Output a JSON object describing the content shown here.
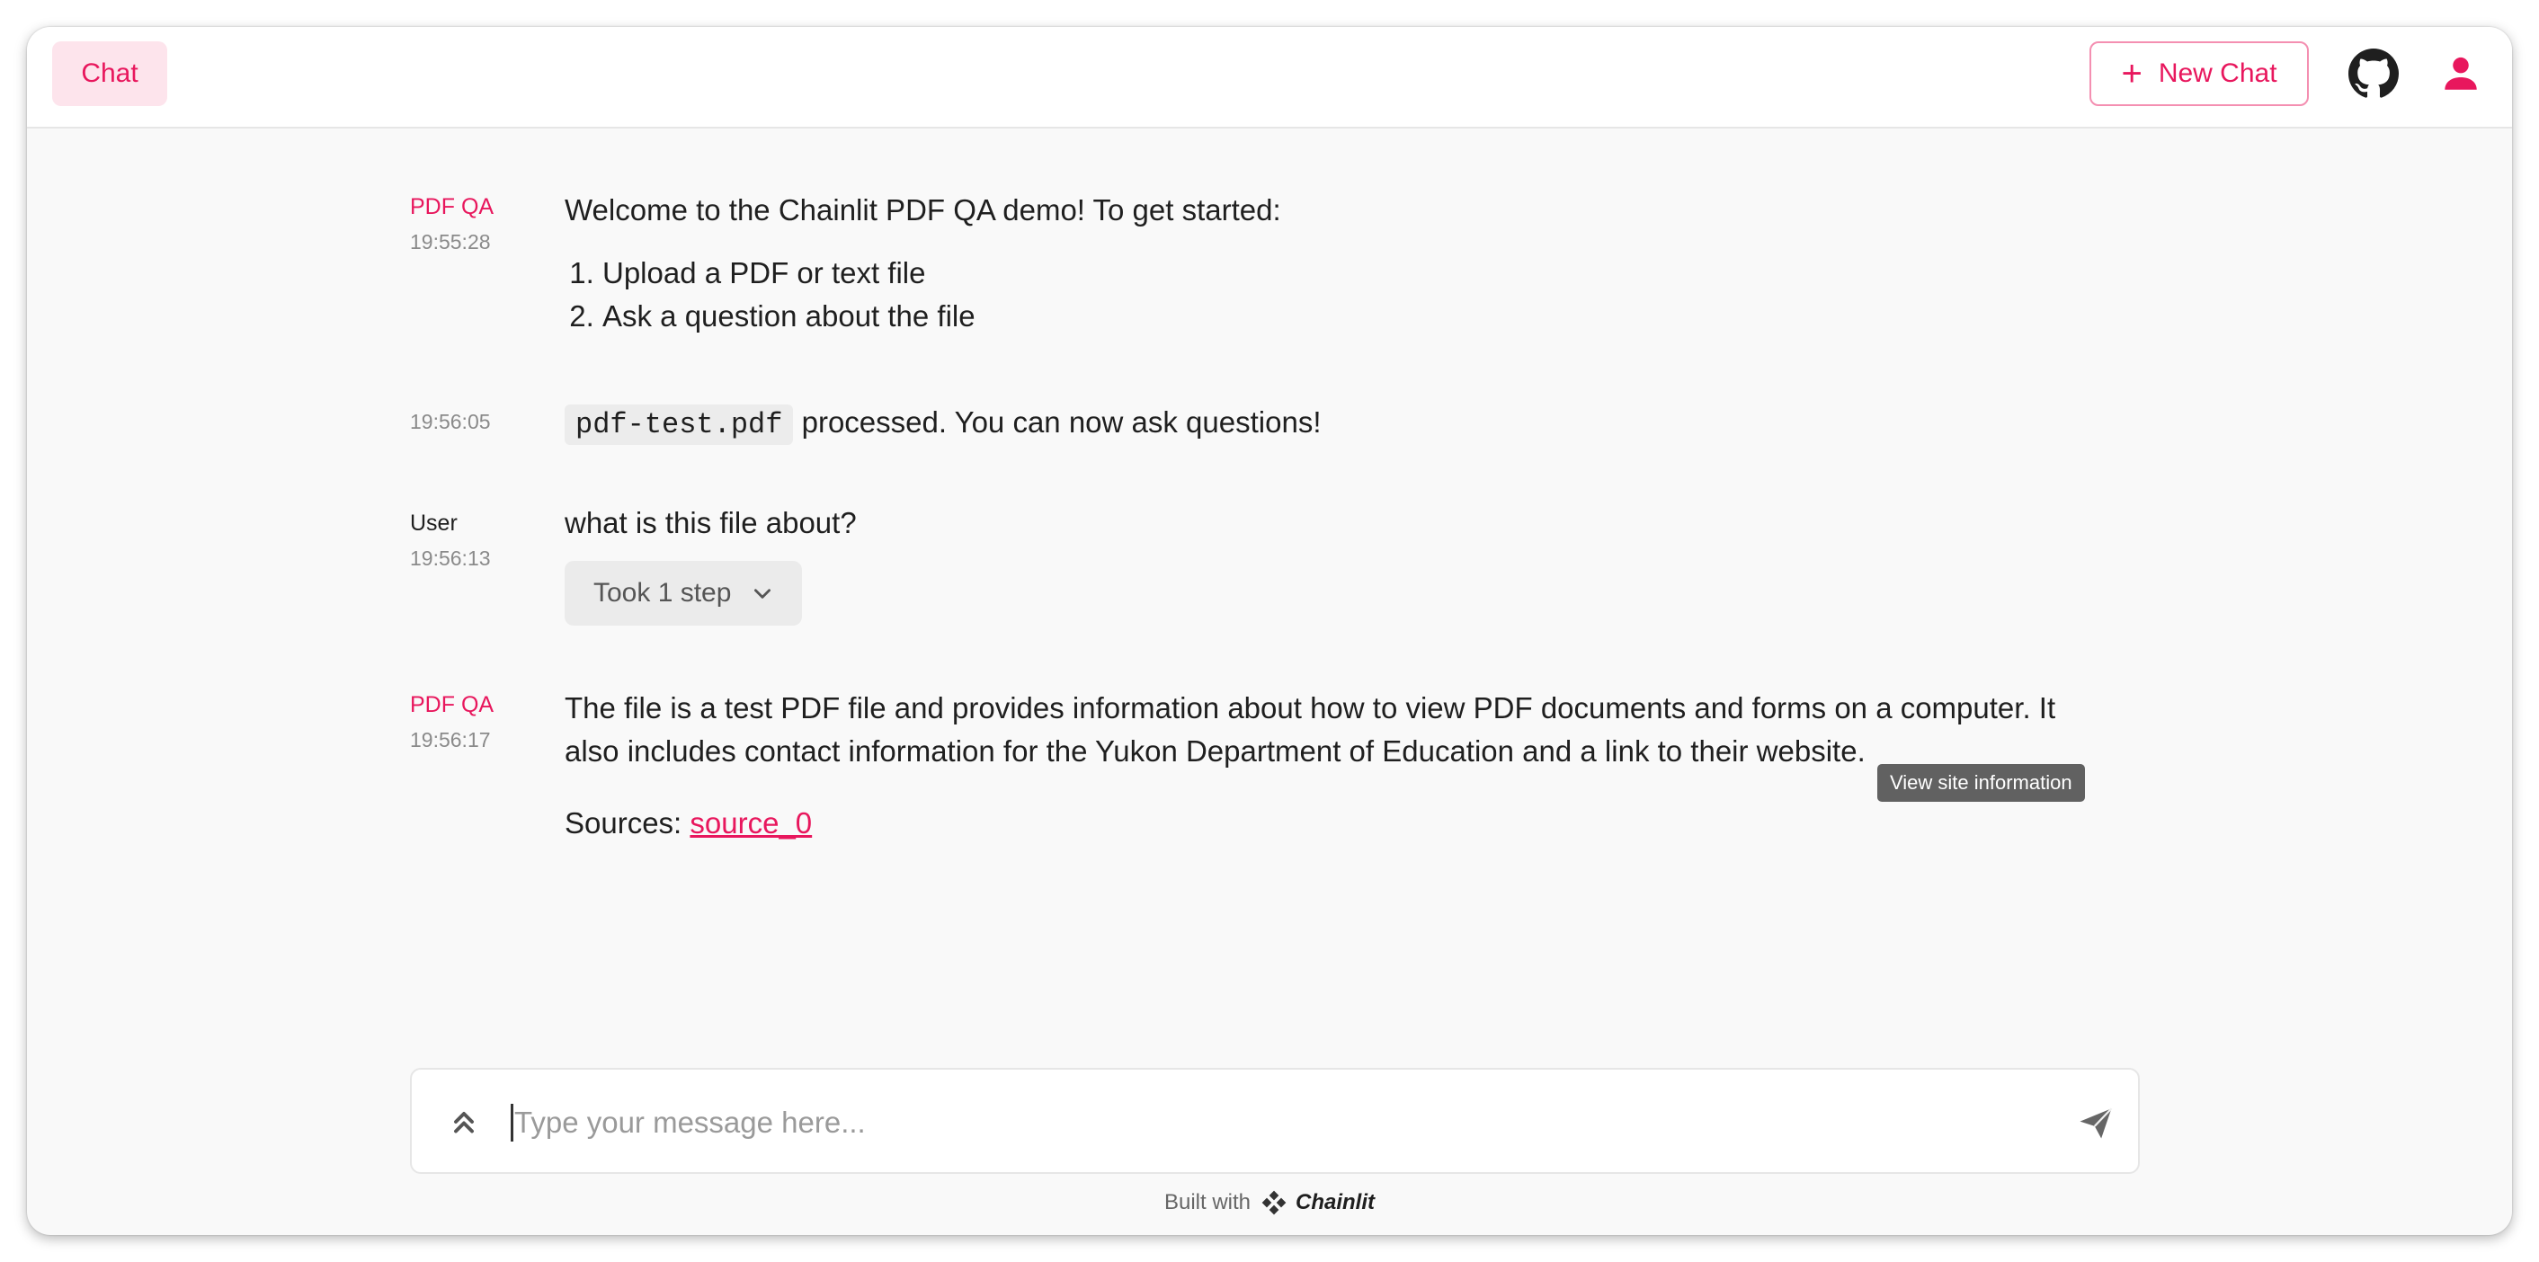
{
  "header": {
    "tab_label": "Chat",
    "new_chat_label": "New Chat",
    "accent_color": "#e8175d"
  },
  "messages": [
    {
      "author": "PDF QA",
      "time": "19:55:28",
      "text": "Welcome to the Chainlit PDF QA demo! To get started:",
      "list": [
        "Upload a PDF or text file",
        "Ask a question about the file"
      ]
    },
    {
      "author": "",
      "time": "19:56:05",
      "code": "pdf-test.pdf",
      "text": " processed. You can now ask questions!"
    },
    {
      "author": "User",
      "time": "19:56:13",
      "text": "what is this file about?",
      "step_label": "Took 1 step"
    },
    {
      "author": "PDF QA",
      "time": "19:56:17",
      "text_line1": "The file is a test PDF file and provides information about how to view PDF documents and forms on a computer. It",
      "text_line2": "also includes contact information for the Yukon Department of Education and a link to their website.",
      "sources_label": "Sources: ",
      "source_link": "source_0"
    }
  ],
  "tooltip": "View site information",
  "composer": {
    "placeholder": "Type your message here..."
  },
  "footer": {
    "built_with": "Built with",
    "brand": "Chainlit"
  }
}
